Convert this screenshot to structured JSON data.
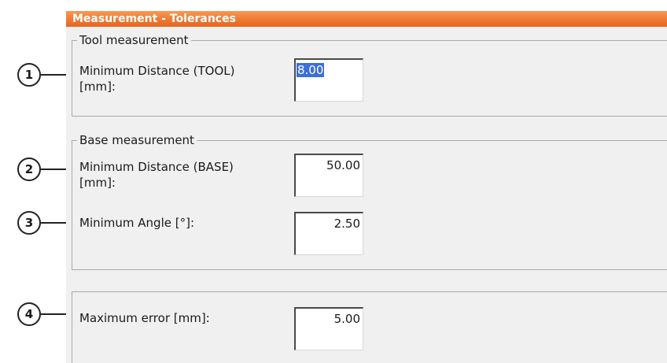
{
  "window": {
    "title": "Measurement - Tolerances"
  },
  "tool_group": {
    "legend": "Tool measurement",
    "min_distance": {
      "label": "Minimum Distance (TOOL)\n[mm]:",
      "value": "8.00"
    }
  },
  "base_group": {
    "legend": "Base measurement",
    "min_distance": {
      "label": "Minimum Distance (BASE)\n[mm]:",
      "value": "50.00"
    },
    "min_angle": {
      "label": "Minimum Angle [°]:",
      "value": "2.50"
    }
  },
  "error_group": {
    "max_error": {
      "label": "Maximum error [mm]:",
      "value": "5.00"
    }
  },
  "callouts": [
    "1",
    "2",
    "3",
    "4"
  ]
}
